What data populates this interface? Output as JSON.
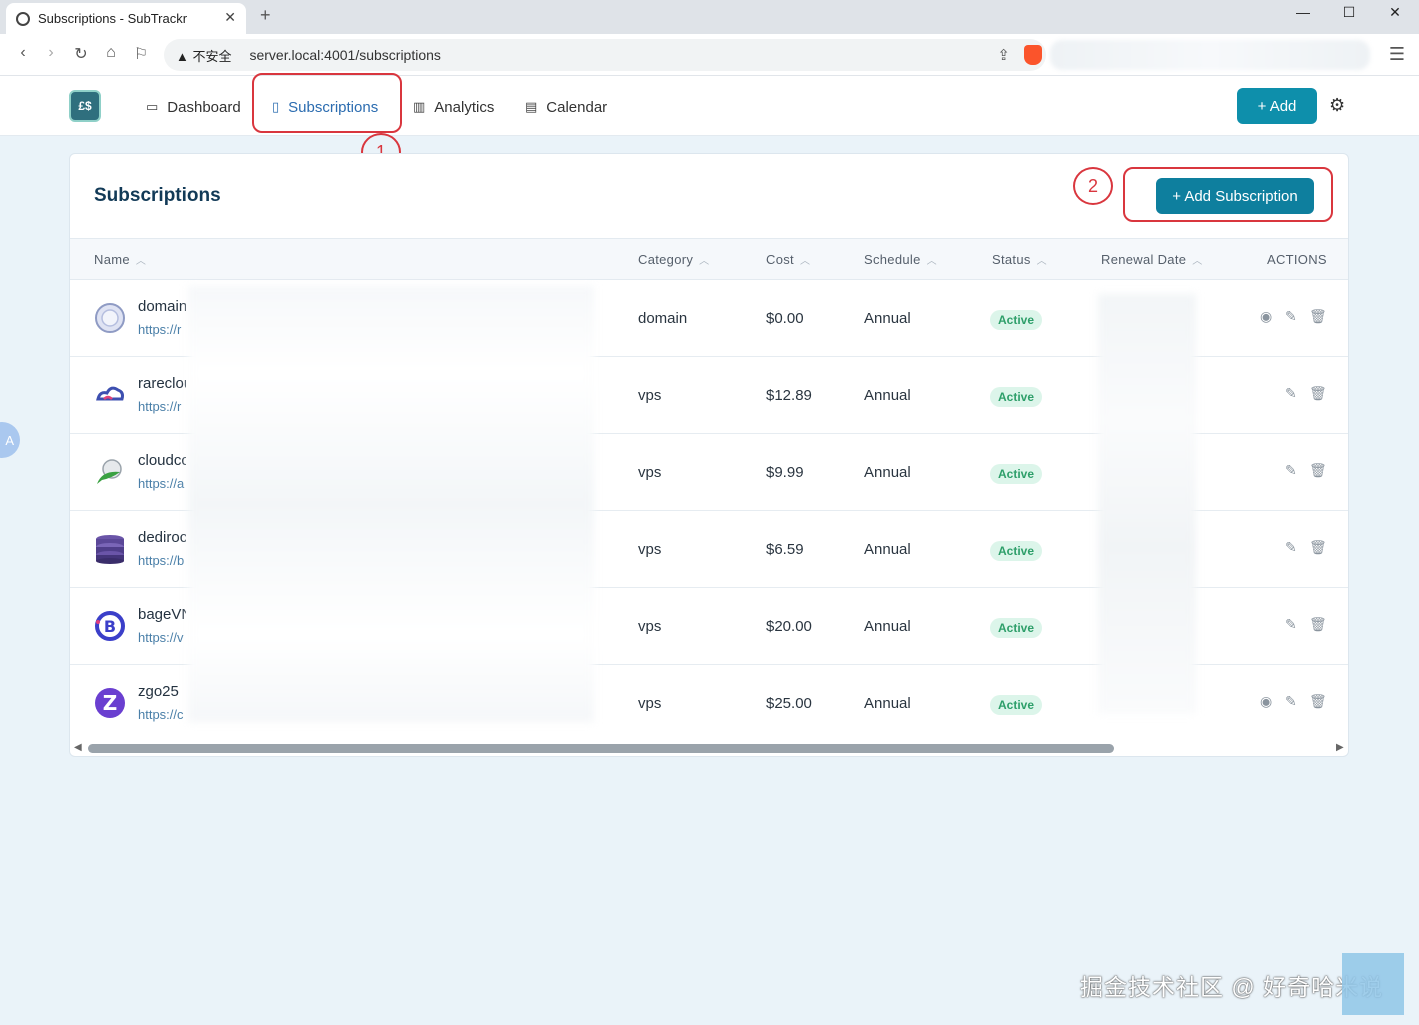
{
  "browser": {
    "tab_title": "Subscriptions - SubTrackr",
    "tab_close": "✕",
    "new_tab": "+",
    "security_label": "▲ 不安全",
    "url": "server.local:4001/subscriptions"
  },
  "app": {
    "logo_text": "£$",
    "nav": [
      {
        "label": "Dashboard"
      },
      {
        "label": "Subscriptions"
      },
      {
        "label": "Analytics"
      },
      {
        "label": "Calendar"
      }
    ],
    "add_label": "+ Add"
  },
  "annotations": {
    "one": "1",
    "two": "2"
  },
  "card": {
    "title": "Subscriptions",
    "add_subscription_label": "+ Add Subscription",
    "columns": [
      "Name",
      "Category",
      "Cost",
      "Schedule",
      "Status",
      "Renewal Date",
      "ACTIONS"
    ]
  },
  "rows": [
    {
      "name": "domain",
      "url": "https://r",
      "category": "domain",
      "cost": "$0.00",
      "schedule": "Annual",
      "status": "Active",
      "icon": "globe-icon",
      "has_view": true
    },
    {
      "name": "rareclou",
      "url": "https://r",
      "category": "vps",
      "cost": "$12.89",
      "schedule": "Annual",
      "status": "Active",
      "icon": "cloud-logo-icon",
      "has_view": false
    },
    {
      "name": "cloudcc",
      "url": "https://a",
      "category": "vps",
      "cost": "$9.99",
      "schedule": "Annual",
      "status": "Active",
      "icon": "leaf-logo-icon",
      "has_view": false
    },
    {
      "name": "dediroc",
      "url": "https://b",
      "category": "vps",
      "cost": "$6.59",
      "schedule": "Annual",
      "status": "Active",
      "icon": "database-icon",
      "has_view": false
    },
    {
      "name": "bageVN",
      "url": "https://v",
      "category": "vps",
      "cost": "$20.00",
      "schedule": "Annual",
      "status": "Active",
      "icon": "b-logo-icon",
      "has_view": false
    },
    {
      "name": "zgo25",
      "url": "https://c",
      "category": "vps",
      "cost": "$25.00",
      "schedule": "Annual",
      "status": "Active",
      "icon": "z-logo-icon",
      "has_view": true
    }
  ],
  "side_button": "A",
  "watermark": "掘金技术社区 @ 好奇哈米说",
  "colors": {
    "accent": "#0e8fab",
    "annotation": "#d9363e",
    "active_badge": "#2e9f6a"
  }
}
